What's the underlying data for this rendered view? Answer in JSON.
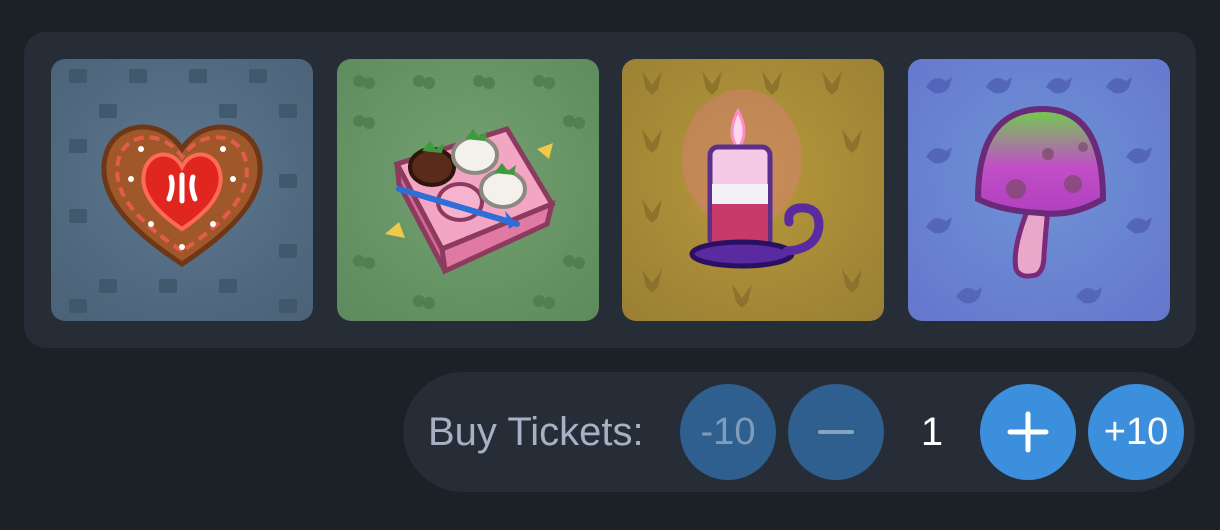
{
  "gift_panel": {
    "cards": [
      {
        "name": "gingerbread heart",
        "icon": "gingerbread-heart-icon",
        "pattern_icon": "gift-box-icon",
        "bg": "#4f667c"
      },
      {
        "name": "chocolate strawberries box",
        "icon": "strawberry-box-icon",
        "pattern_icon": "cherry-icon",
        "bg": "#629160"
      },
      {
        "name": "candle",
        "icon": "candle-icon",
        "pattern_icon": "goat-head-icon",
        "bg": "#a48837"
      },
      {
        "name": "mushroom",
        "icon": "mushroom-icon",
        "pattern_icon": "crow-icon",
        "bg": "#6a85d2"
      }
    ]
  },
  "tickets": {
    "label": "Buy Tickets:",
    "minus_ten_label": "-10",
    "quantity": "1",
    "plus_ten_label": "+10",
    "minus_icon": "minus-icon",
    "plus_icon": "plus-icon",
    "minus_disabled": true
  },
  "colors": {
    "background": "#1c2027",
    "panel": "#272d37",
    "accent": "#3b8fdc",
    "accent_disabled": "#2f5f8e",
    "label": "#a5b1c4"
  }
}
